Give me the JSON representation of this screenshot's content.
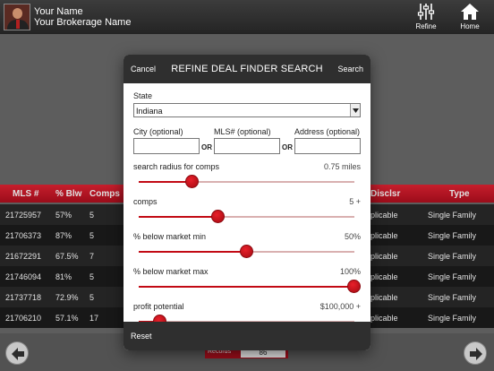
{
  "header": {
    "user_name": "Your Name",
    "brokerage_name": "Your Brokerage Name",
    "refine_label": "Refine",
    "home_label": "Home"
  },
  "table": {
    "columns": [
      "MLS #",
      "% Blw",
      "Comps",
      "Disclsr",
      "Type"
    ],
    "rows": [
      {
        "mls": "21725957",
        "blw": "57%",
        "comps": "5",
        "disclsr": "plicable",
        "type": "Single Family"
      },
      {
        "mls": "21706373",
        "blw": "87%",
        "comps": "5",
        "disclsr": "plicable",
        "type": "Single Family"
      },
      {
        "mls": "21672291",
        "blw": "67.5%",
        "comps": "7",
        "disclsr": "plicable",
        "type": "Single Family"
      },
      {
        "mls": "21746094",
        "blw": "81%",
        "comps": "5",
        "disclsr": "plicable",
        "type": "Single Family"
      },
      {
        "mls": "21737718",
        "blw": "72.9%",
        "comps": "5",
        "disclsr": "plicable",
        "type": "Single Family"
      },
      {
        "mls": "21706210",
        "blw": "57.1%",
        "comps": "17",
        "disclsr": "plicable",
        "type": "Single Family"
      }
    ]
  },
  "footer": {
    "records_label": "Records",
    "records_value": "86"
  },
  "modal": {
    "cancel_label": "Cancel",
    "title": "REFINE DEAL FINDER SEARCH",
    "search_label": "Search",
    "reset_label": "Reset",
    "state_label": "State",
    "state_value": "Indiana",
    "city_label": "City (optional)",
    "mls_label": "MLS# (optional)",
    "address_label": "Address (optional)",
    "or_text": "OR",
    "sliders": [
      {
        "label": "search radius for comps",
        "value_text": "0.75 miles",
        "fraction": 0.25
      },
      {
        "label": "comps",
        "value_text": "5 +",
        "fraction": 0.37
      },
      {
        "label": "% below market min",
        "value_text": "50%",
        "fraction": 0.5
      },
      {
        "label": "% below market max",
        "value_text": "100%",
        "fraction": 1.0
      },
      {
        "label": "profit potential",
        "value_text": "$100,000 +",
        "fraction": 0.1
      }
    ]
  },
  "colors": {
    "accent": "#c20a14",
    "header_bg": "#2f2f2f",
    "table_header": "#d11a2a"
  }
}
